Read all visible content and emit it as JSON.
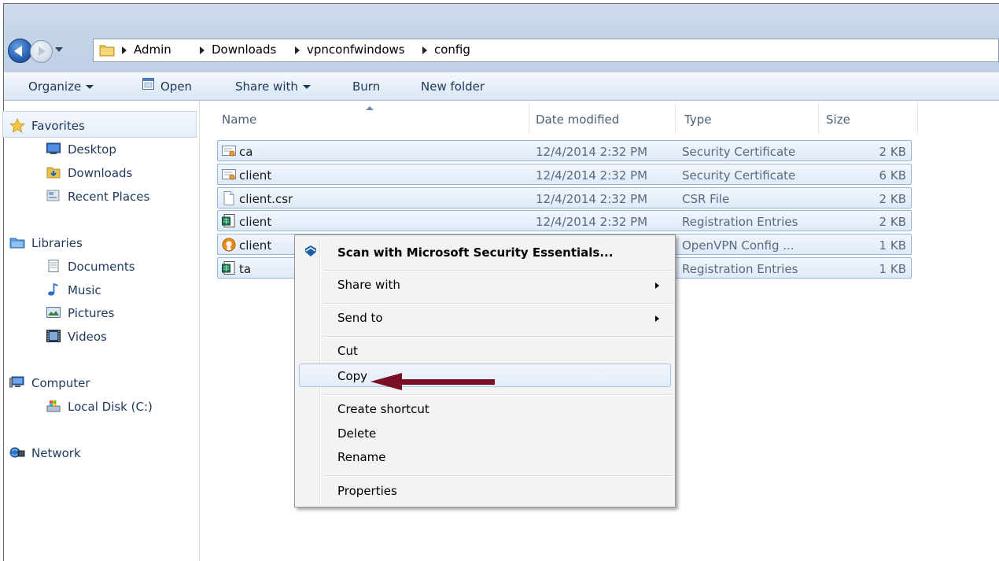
{
  "breadcrumb": [
    "Admin",
    "Downloads",
    "vpnconfwindows",
    "config"
  ],
  "toolbar": {
    "organize": "Organize",
    "open": "Open",
    "share_with": "Share with",
    "burn": "Burn",
    "new_folder": "New folder"
  },
  "navpane": {
    "favorites": "Favorites",
    "desktop": "Desktop",
    "downloads": "Downloads",
    "recent_places": "Recent Places",
    "libraries": "Libraries",
    "documents": "Documents",
    "music": "Music",
    "pictures": "Pictures",
    "videos": "Videos",
    "computer": "Computer",
    "local_disk": "Local Disk (C:)",
    "network": "Network"
  },
  "columns": {
    "name": "Name",
    "date": "Date modified",
    "type": "Type",
    "size": "Size"
  },
  "files": [
    {
      "name": "ca",
      "date": "12/4/2014 2:32 PM",
      "type": "Security Certificate",
      "size": "2 KB",
      "icon": "certificate-icon"
    },
    {
      "name": "client",
      "date": "12/4/2014 2:32 PM",
      "type": "Security Certificate",
      "size": "6 KB",
      "icon": "certificate-icon"
    },
    {
      "name": "client.csr",
      "date": "12/4/2014 2:32 PM",
      "type": "CSR File",
      "size": "2 KB",
      "icon": "blank-file-icon"
    },
    {
      "name": "client",
      "date": "12/4/2014 2:32 PM",
      "type": "Registration Entries",
      "size": "2 KB",
      "icon": "registry-icon"
    },
    {
      "name": "client",
      "date": "",
      "type": "OpenVPN Config ...",
      "size": "1 KB",
      "icon": "openvpn-icon"
    },
    {
      "name": "ta",
      "date": "",
      "type": "Registration Entries",
      "size": "1 KB",
      "icon": "registry-icon"
    }
  ],
  "context_menu": {
    "scan": "Scan with Microsoft Security Essentials...",
    "share_with": "Share with",
    "send_to": "Send to",
    "cut": "Cut",
    "copy": "Copy",
    "create_shortcut": "Create shortcut",
    "delete": "Delete",
    "rename": "Rename",
    "properties": "Properties"
  },
  "annotation_arrow_color": "#7a1028"
}
